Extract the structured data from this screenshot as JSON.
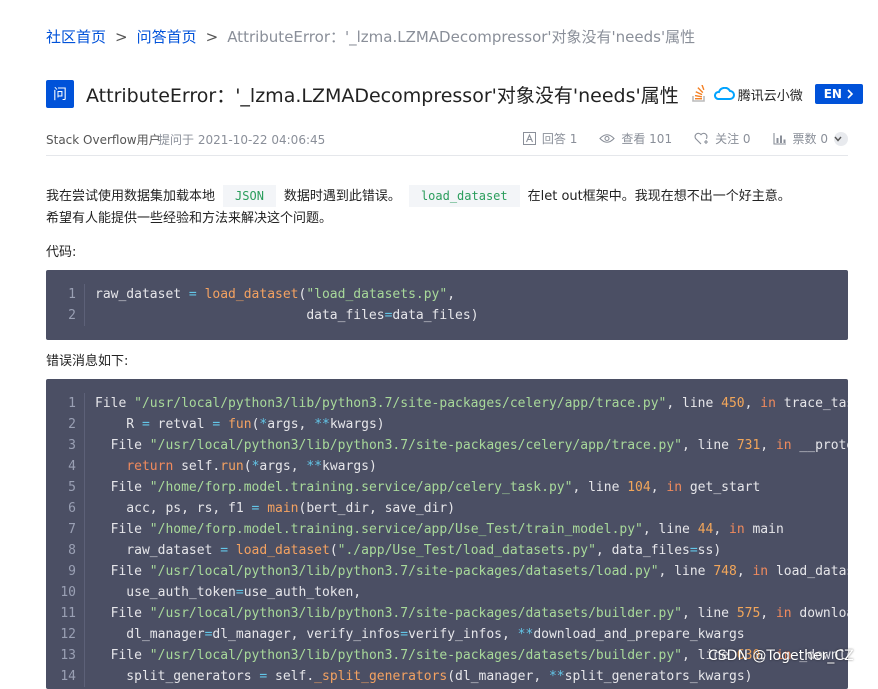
{
  "breadcrumb": {
    "home": "社区首页",
    "qa": "问答首页",
    "current": "AttributeError：'_lzma.LZMADecompressor'对象没有'needs'属性"
  },
  "question": {
    "badge": "问",
    "title": "AttributeError：'_lzma.LZMADecompressor'对象没有'needs'属性",
    "source_brand": "腾讯云小微",
    "lang_button": "EN",
    "author": "Stack Overflow用户",
    "asked": "提问于 2021-10-22 04:06:45"
  },
  "stats": {
    "answers": "回答 1",
    "views": "查看 101",
    "follows": "关注 0",
    "votes": "票数 0"
  },
  "body": {
    "p1_a": "我在尝试使用数据集加载本地",
    "p1_code1": "JSON",
    "p1_b": "数据时遇到此错误。",
    "p1_code2": "load_dataset",
    "p1_c": "在let out框架中。我现在想不出一个好主意。",
    "p2": "希望有人能提供一些经验和方法来解决这个问题。",
    "code_label": "代码:",
    "error_label": "错误消息如下:"
  },
  "watermark": "CSDN @Together_CZ",
  "colors": {
    "accent": "#0052d9",
    "code_bg": "#4b4f64"
  }
}
